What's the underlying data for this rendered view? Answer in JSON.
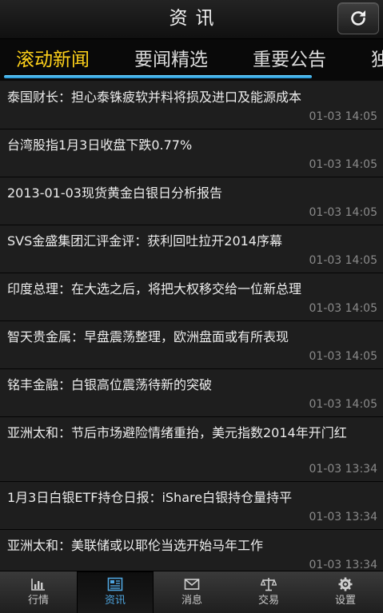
{
  "header": {
    "title": "资讯"
  },
  "tabs": [
    {
      "label": "滚动新闻",
      "active": true
    },
    {
      "label": "要闻精选",
      "active": false
    },
    {
      "label": "重要公告",
      "active": false
    },
    {
      "label": "独",
      "active": false
    }
  ],
  "news": [
    {
      "title": "泰国财长：担心泰铢疲软并料将损及进口及能源成本",
      "time": "01-03 14:05"
    },
    {
      "title": "台湾股指1月3日收盘下跌0.77%",
      "time": "01-03 14:05"
    },
    {
      "title": "2013-01-03现货黄金白银日分析报告",
      "time": "01-03 14:05"
    },
    {
      "title": "SVS金盛集团汇评金评：获利回吐拉开2014序幕",
      "time": "01-03 14:05"
    },
    {
      "title": "印度总理：在大选之后，将把大权移交给一位新总理",
      "time": "01-03 14:05"
    },
    {
      "title": "智天贵金属：早盘震荡整理，欧洲盘面或有所表现",
      "time": "01-03 14:05"
    },
    {
      "title": "铭丰金融：白银高位震荡待新的突破",
      "time": "01-03 14:05"
    },
    {
      "title": "亚洲太和：节后市场避险情绪重抬，美元指数2014年开门红",
      "time": "01-03 13:34"
    },
    {
      "title": "1月3日白银ETF持仓日报：iShare白银持仓量持平",
      "time": "01-03 13:34"
    },
    {
      "title": "亚洲太和：美联储或以耶伦当选开始马年工作",
      "time": "01-03 13:34"
    }
  ],
  "bottom_nav": [
    {
      "label": "行情",
      "icon": "bar-chart-icon",
      "active": false
    },
    {
      "label": "资讯",
      "icon": "news-icon",
      "active": true
    },
    {
      "label": "消息",
      "icon": "envelope-icon",
      "active": false
    },
    {
      "label": "交易",
      "icon": "scales-icon",
      "active": false
    },
    {
      "label": "设置",
      "icon": "gear-icon",
      "active": false
    }
  ],
  "colors": {
    "accent_tab": "#ffd21a",
    "indicator": "#2aa9e8",
    "active_nav_label": "#4fa6e0"
  }
}
